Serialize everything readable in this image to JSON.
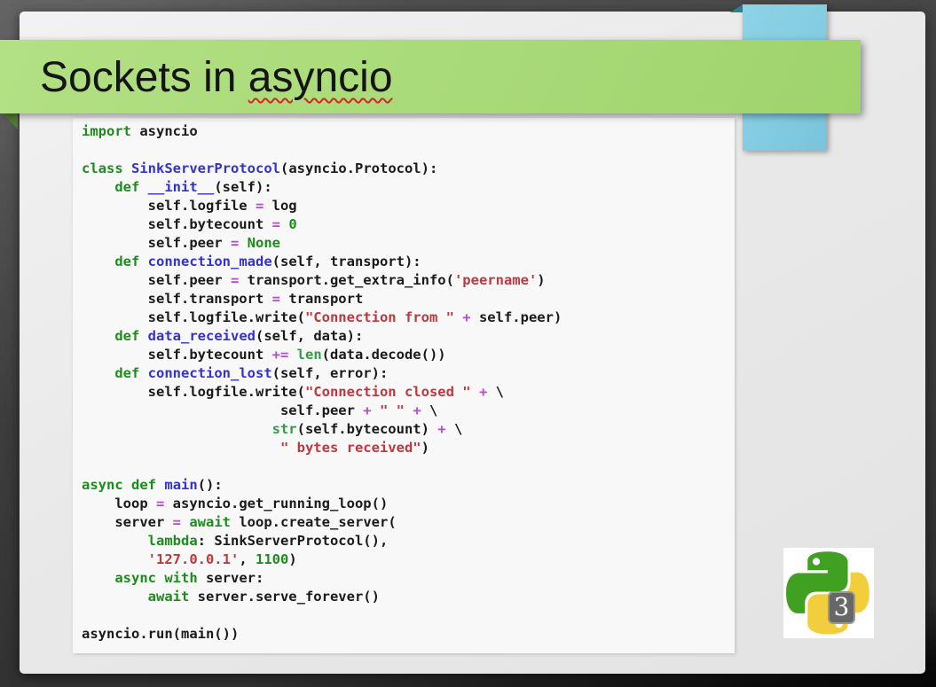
{
  "slide": {
    "title": {
      "text_before": "Sockets in ",
      "misspelled_word": "asyncio"
    }
  },
  "logo": {
    "name": "python-3-logo",
    "badge": "3"
  },
  "colors": {
    "banner_green": "#a9da78",
    "banner_fold_green": "#4e7c2e",
    "ribbon_blue": "#83cce1",
    "ribbon_fold_blue": "#2e7f99",
    "code_background": "#f8f8f8",
    "text": "#1a1a1a",
    "keyword": "#1c8c1c",
    "function_name": "#3333cc",
    "string": "#b93a3f",
    "operator": "#b44bd0",
    "builtin": "#2f9e44",
    "number": "#1c8c1c",
    "python_green": "#3fa021",
    "python_yellow": "#f2ce3c"
  },
  "code": {
    "language": "python",
    "lines": [
      [
        [
          "k",
          "import"
        ],
        [
          "d",
          " asyncio"
        ]
      ],
      [],
      [
        [
          "k",
          "class"
        ],
        [
          "d",
          " "
        ],
        [
          "n",
          "SinkServerProtocol"
        ],
        [
          "d",
          "(asyncio.Protocol):"
        ]
      ],
      [
        [
          "d",
          "    "
        ],
        [
          "k",
          "def"
        ],
        [
          "d",
          " "
        ],
        [
          "n",
          "__init__"
        ],
        [
          "d",
          "(self):"
        ]
      ],
      [
        [
          "d",
          "        self.logfile "
        ],
        [
          "o",
          "="
        ],
        [
          "d",
          " log"
        ]
      ],
      [
        [
          "d",
          "        self.bytecount "
        ],
        [
          "o",
          "="
        ],
        [
          "d",
          " "
        ],
        [
          "num",
          "0"
        ]
      ],
      [
        [
          "d",
          "        self.peer "
        ],
        [
          "o",
          "="
        ],
        [
          "d",
          " "
        ],
        [
          "k",
          "None"
        ]
      ],
      [
        [
          "d",
          "    "
        ],
        [
          "k",
          "def"
        ],
        [
          "d",
          " "
        ],
        [
          "n",
          "connection_made"
        ],
        [
          "d",
          "(self, transport):"
        ]
      ],
      [
        [
          "d",
          "        self.peer "
        ],
        [
          "o",
          "="
        ],
        [
          "d",
          " transport.get_extra_info("
        ],
        [
          "s",
          "'peername'"
        ],
        [
          "d",
          ")"
        ]
      ],
      [
        [
          "d",
          "        self.transport "
        ],
        [
          "o",
          "="
        ],
        [
          "d",
          " transport"
        ]
      ],
      [
        [
          "d",
          "        self.logfile.write("
        ],
        [
          "s",
          "\"Connection from \""
        ],
        [
          "d",
          " "
        ],
        [
          "o",
          "+"
        ],
        [
          "d",
          " self.peer)"
        ]
      ],
      [
        [
          "d",
          "    "
        ],
        [
          "k",
          "def"
        ],
        [
          "d",
          " "
        ],
        [
          "n",
          "data_received"
        ],
        [
          "d",
          "(self, data):"
        ]
      ],
      [
        [
          "d",
          "        self.bytecount "
        ],
        [
          "o",
          "+="
        ],
        [
          "d",
          " "
        ],
        [
          "b",
          "len"
        ],
        [
          "d",
          "(data.decode())"
        ]
      ],
      [
        [
          "d",
          "    "
        ],
        [
          "k",
          "def"
        ],
        [
          "d",
          " "
        ],
        [
          "n",
          "connection_lost"
        ],
        [
          "d",
          "(self, error):"
        ]
      ],
      [
        [
          "d",
          "        self.logfile.write("
        ],
        [
          "s",
          "\"Connection closed \""
        ],
        [
          "d",
          " "
        ],
        [
          "o",
          "+"
        ],
        [
          "d",
          " \\"
        ]
      ],
      [
        [
          "d",
          "                        self.peer "
        ],
        [
          "o",
          "+"
        ],
        [
          "d",
          " "
        ],
        [
          "s",
          "\" \""
        ],
        [
          "d",
          " "
        ],
        [
          "o",
          "+"
        ],
        [
          "d",
          " \\"
        ]
      ],
      [
        [
          "d",
          "                       "
        ],
        [
          "b",
          "str"
        ],
        [
          "d",
          "(self.bytecount) "
        ],
        [
          "o",
          "+"
        ],
        [
          "d",
          " \\"
        ]
      ],
      [
        [
          "d",
          "                        "
        ],
        [
          "s",
          "\" bytes received\""
        ],
        [
          "d",
          ")"
        ]
      ],
      [],
      [
        [
          "k",
          "async"
        ],
        [
          "d",
          " "
        ],
        [
          "k",
          "def"
        ],
        [
          "d",
          " "
        ],
        [
          "n",
          "main"
        ],
        [
          "d",
          "():"
        ]
      ],
      [
        [
          "d",
          "    loop "
        ],
        [
          "o",
          "="
        ],
        [
          "d",
          " asyncio.get_running_loop()"
        ]
      ],
      [
        [
          "d",
          "    server "
        ],
        [
          "o",
          "="
        ],
        [
          "d",
          " "
        ],
        [
          "k",
          "await"
        ],
        [
          "d",
          " loop.create_server("
        ]
      ],
      [
        [
          "d",
          "        "
        ],
        [
          "k",
          "lambda"
        ],
        [
          "d",
          ": SinkServerProtocol(),"
        ]
      ],
      [
        [
          "d",
          "        "
        ],
        [
          "s",
          "'127.0.0.1'"
        ],
        [
          "d",
          ", "
        ],
        [
          "num",
          "1100"
        ],
        [
          "d",
          ")"
        ]
      ],
      [
        [
          "d",
          "    "
        ],
        [
          "k",
          "async"
        ],
        [
          "d",
          " "
        ],
        [
          "k",
          "with"
        ],
        [
          "d",
          " server:"
        ]
      ],
      [
        [
          "d",
          "        "
        ],
        [
          "k",
          "await"
        ],
        [
          "d",
          " server.serve_forever()"
        ]
      ],
      [],
      [
        [
          "d",
          "asyncio.run(main())"
        ]
      ]
    ]
  }
}
